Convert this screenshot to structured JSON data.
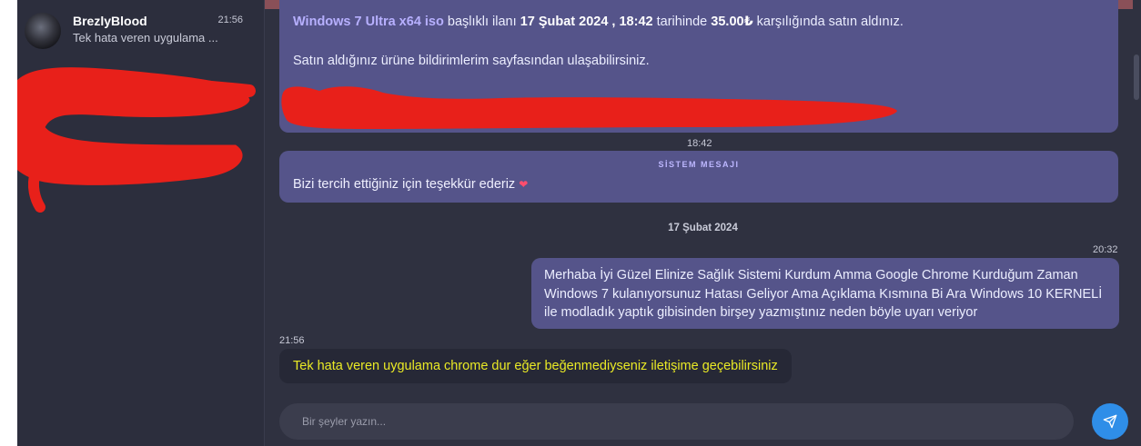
{
  "sidebar": {
    "conversations": [
      {
        "name": "BrezlyBlood",
        "time": "21:56",
        "preview": "Tek hata veren uygulama ..."
      }
    ],
    "redaction_color": "#e8201a"
  },
  "chat": {
    "order_message": {
      "product": "Windows 7 Ultra x64 iso",
      "text_mid": " başlıklı ilanı ",
      "datetime": "17 Şubat 2024 , 18:42",
      "text_mid2": " tarihinde ",
      "price": "35.00₺",
      "text_end": " karşılığında satın aldınız.",
      "line2": "Satın aldığınız ürüne bildirimlerim sayfasından ulaşabilirsiniz."
    },
    "system_time": "18:42",
    "system_message": {
      "title": "SİSTEM MESAJI",
      "text": "Bizi tercih ettiğiniz için teşekkür ederiz",
      "emoji": "❤"
    },
    "date_separator": "17 Şubat 2024",
    "outgoing": {
      "time": "20:32",
      "text": "Merhaba İyi Güzel Elinize Sağlık Sistemi Kurdum Amma Google Chrome Kurduğum Zaman Windows 7 kulanıyorsunuz Hatası Geliyor Ama Açıklama Kısmına Bi Ara Windows 10 KERNELİ ile modladık yaptık gibisinden birşey yazmıştınız neden böyle uyarı veriyor"
    },
    "incoming": {
      "time": "21:56",
      "text": "Tek hata veren uygulama chrome dur eğer beğenmediyseniz iletişime geçebilirsiniz"
    },
    "composer": {
      "placeholder": "Bir şeyler yazın..."
    }
  },
  "colors": {
    "accent": "#2f8ee8",
    "bubble": "#55548a",
    "incoming_text": "#eaea25"
  }
}
